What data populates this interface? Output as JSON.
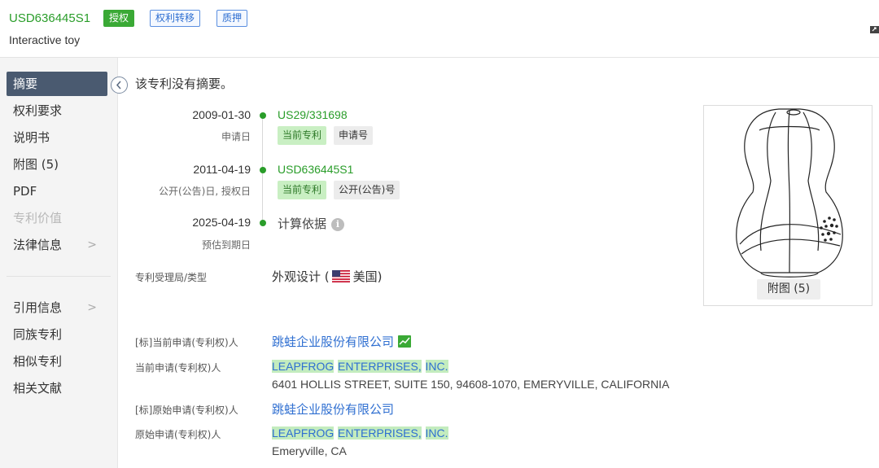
{
  "header": {
    "patent_number": "USD636445S1",
    "title": "Interactive toy",
    "tags": {
      "granted": "授权",
      "transfer": "权利转移",
      "pledge": "质押"
    }
  },
  "sidebar": {
    "items": [
      {
        "label": "摘要"
      },
      {
        "label": "权利要求"
      },
      {
        "label": "说明书"
      },
      {
        "label": "附图 (5)"
      },
      {
        "label": "PDF"
      },
      {
        "label": "专利价值"
      },
      {
        "label": "法律信息"
      },
      {
        "label": "引用信息"
      },
      {
        "label": "同族专利"
      },
      {
        "label": "相似专利"
      },
      {
        "label": "相关文献"
      }
    ],
    "chevron": ">"
  },
  "abstract": {
    "text": "该专利没有摘要。"
  },
  "timeline": {
    "events": [
      {
        "date": "2009-01-30",
        "label": "申请日",
        "number": "US29/331698",
        "badge_current": "当前专利",
        "badge_type": "申请号"
      },
      {
        "date": "2011-04-19",
        "label": "公开(公告)日, 授权日",
        "number": "USD636445S1",
        "badge_current": "当前专利",
        "badge_type": "公开(公告)号"
      },
      {
        "date": "2025-04-19",
        "label": "预估到期日",
        "text": "计算依据",
        "info_icon": "i"
      }
    ]
  },
  "office": {
    "label": "专利受理局/类型",
    "type": "外观设计 (",
    "country": "美国)",
    "flag": "us-flag-icon"
  },
  "applicants": {
    "std_current_label": "[标]当前申请(专利权)人",
    "std_current_value": "跳蛙企业股份有限公司",
    "current_label": "当前申请(专利权)人",
    "current_name_parts": [
      "LEAPFROG",
      "ENTERPRISES,",
      "INC."
    ],
    "current_address": "6401 HOLLIS STREET, SUITE 150, 94608-1070, EMERYVILLE, CALIFORNIA",
    "std_original_label": "[标]原始申请(专利权)人",
    "std_original_value": "跳蛙企业股份有限公司",
    "original_label": "原始申请(专利权)人",
    "original_name_parts": [
      "LEAPFROG",
      "ENTERPRISES,",
      "INC."
    ],
    "original_address": "Emeryville, CA"
  },
  "drawing": {
    "caption": "附图 (5)"
  },
  "colors": {
    "accent_green": "#2a9d2a",
    "link_blue": "#2f6fd1",
    "sidebar_active": "#4a5a70",
    "highlight": "#c3ecbe"
  }
}
